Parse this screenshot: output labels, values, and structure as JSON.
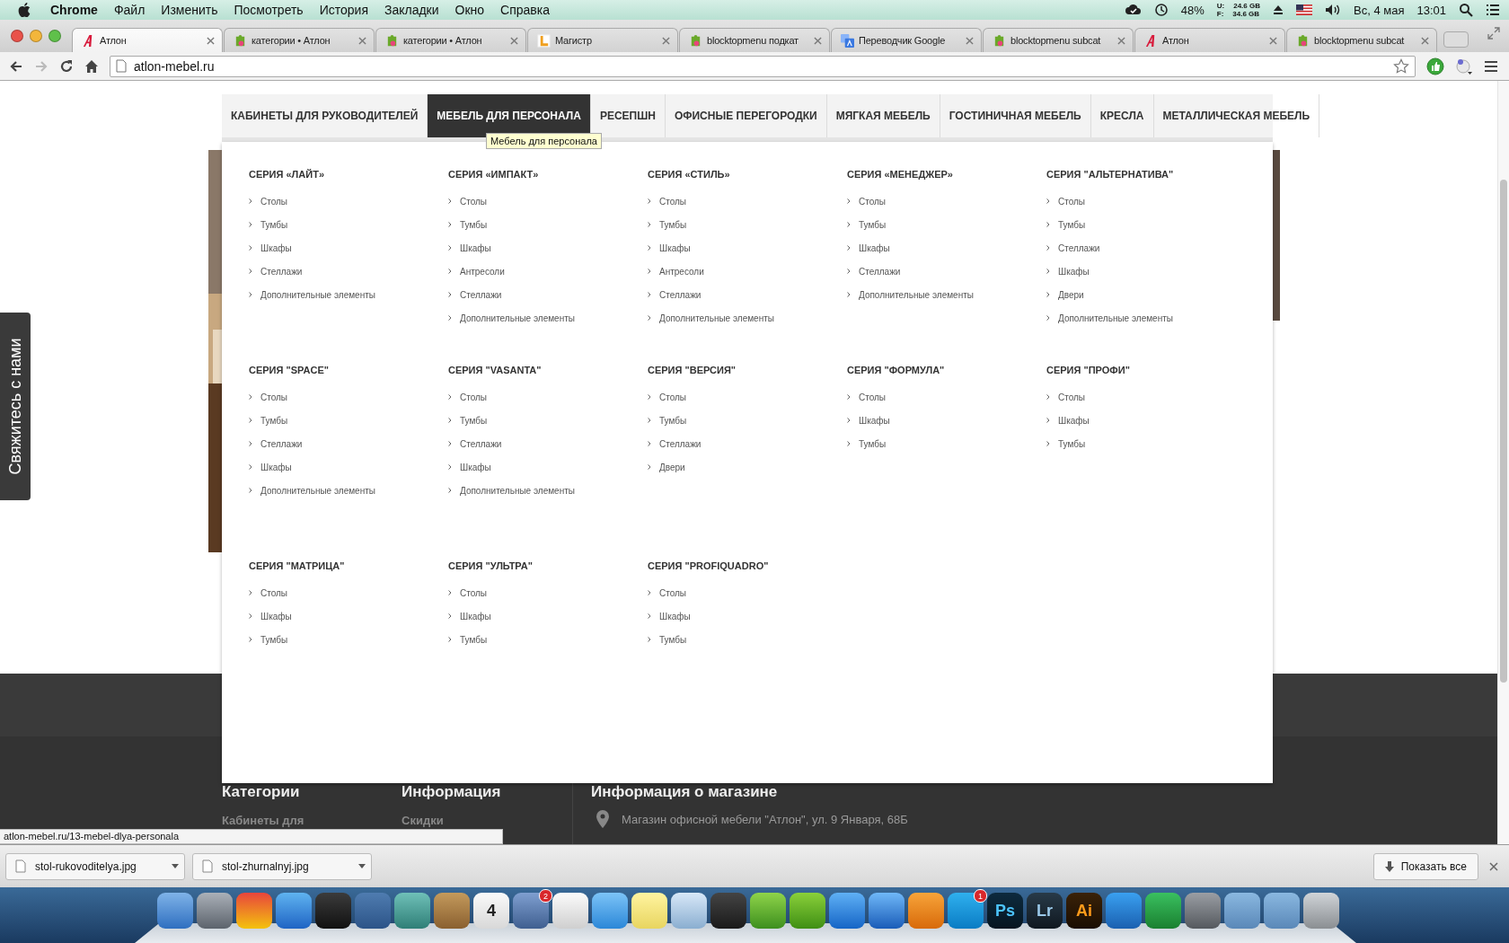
{
  "menubar": {
    "app": "Chrome",
    "items": [
      "Файл",
      "Изменить",
      "Посмотреть",
      "История",
      "Закладки",
      "Окно",
      "Справка"
    ],
    "battery": "48%",
    "storage": [
      {
        "label": "U:",
        "value": "24.6 GB"
      },
      {
        "label": "F:",
        "value": "34.6 GB"
      }
    ],
    "date": "Вс, 4 мая",
    "time": "13:01"
  },
  "tabs": [
    {
      "title": "Атлон",
      "kind": "atlon",
      "selected": true
    },
    {
      "title": "категории • Атлон",
      "kind": "shop",
      "selected": false
    },
    {
      "title": "категории • Атлон",
      "kind": "shop",
      "selected": false
    },
    {
      "title": "Магистр",
      "kind": "magistr",
      "selected": false
    },
    {
      "title": "blocktopmenu подкат",
      "kind": "shop",
      "selected": false
    },
    {
      "title": "Переводчик Google",
      "kind": "translate",
      "selected": false
    },
    {
      "title": "blocktopmenu subcat",
      "kind": "shop",
      "selected": false
    },
    {
      "title": "Атлон",
      "kind": "atlon",
      "selected": false
    },
    {
      "title": "blocktopmenu subcat",
      "kind": "shop",
      "selected": false
    }
  ],
  "toolbar": {
    "url": "atlon-mebel.ru",
    "forward_disabled": true
  },
  "nav": [
    {
      "label": "КАБИНЕТЫ ДЛЯ РУКОВОДИТЕЛЕЙ",
      "selected": false
    },
    {
      "label": "МЕБЕЛЬ ДЛЯ ПЕРСОНАЛА",
      "selected": true
    },
    {
      "label": "РЕСЕПШН",
      "selected": false
    },
    {
      "label": "ОФИСНЫЕ ПЕРЕГОРОДКИ",
      "selected": false
    },
    {
      "label": "МЯГКАЯ МЕБЕЛЬ",
      "selected": false
    },
    {
      "label": "ГОСТИНИЧНАЯ МЕБЕЛЬ",
      "selected": false
    },
    {
      "label": "КРЕСЛА",
      "selected": false
    },
    {
      "label": "МЕТАЛЛИЧЕСКАЯ МЕБЕЛЬ",
      "selected": false
    }
  ],
  "tooltip": "Мебель для персонала",
  "series": [
    {
      "title": "СЕРИЯ «ЛАЙТ»",
      "items": [
        "Столы",
        "Тумбы",
        "Шкафы",
        "Стеллажи",
        "Дополнительные элементы"
      ]
    },
    {
      "title": "СЕРИЯ «ИМПАКТ»",
      "items": [
        "Столы",
        "Тумбы",
        "Шкафы",
        "Антресоли",
        "Стеллажи",
        "Дополнительные элементы"
      ]
    },
    {
      "title": "СЕРИЯ «СТИЛЬ»",
      "items": [
        "Столы",
        "Тумбы",
        "Шкафы",
        "Антресоли",
        "Стеллажи",
        "Дополнительные элементы"
      ]
    },
    {
      "title": "СЕРИЯ «МЕНЕДЖЕР»",
      "items": [
        "Столы",
        "Тумбы",
        "Шкафы",
        "Стеллажи",
        "Дополнительные элементы"
      ]
    },
    {
      "title": "СЕРИЯ \"АЛЬТЕРНАТИВА\"",
      "items": [
        "Столы",
        "Тумбы",
        "Стеллажи",
        "Шкафы",
        "Двери",
        "Дополнительные элементы"
      ]
    },
    {
      "title": "СЕРИЯ \"SPACE\"",
      "items": [
        "Столы",
        "Тумбы",
        "Стеллажи",
        "Шкафы",
        "Дополнительные элементы"
      ]
    },
    {
      "title": "СЕРИЯ \"VASANTA\"",
      "items": [
        "Столы",
        "Тумбы",
        "Стеллажи",
        "Шкафы",
        "Дополнительные элементы"
      ]
    },
    {
      "title": "СЕРИЯ \"ВЕРСИЯ\"",
      "items": [
        "Столы",
        "Тумбы",
        "Стеллажи",
        "Двери"
      ]
    },
    {
      "title": "СЕРИЯ \"ФОРМУЛА\"",
      "items": [
        "Столы",
        "Шкафы",
        "Тумбы"
      ]
    },
    {
      "title": "СЕРИЯ \"ПРОФИ\"",
      "items": [
        "Столы",
        "Шкафы",
        "Тумбы"
      ]
    },
    {
      "title": "СЕРИЯ \"МАТРИЦА\"",
      "items": [
        "Столы",
        "Шкафы",
        "Тумбы"
      ]
    },
    {
      "title": "СЕРИЯ \"УЛЬТРА\"",
      "items": [
        "Столы",
        "Шкафы",
        "Тумбы"
      ]
    },
    {
      "title": "СЕРИЯ \"PROFIQUADRO\"",
      "items": [
        "Столы",
        "Шкафы",
        "Тумбы"
      ]
    }
  ],
  "contact_tab": "Свяжитесь с нами",
  "footer": {
    "columns": [
      {
        "heading": "Категории",
        "link": "Кабинеты для"
      },
      {
        "heading": "Информация",
        "link": "Скидки"
      }
    ],
    "store": {
      "heading": "Информация о магазине",
      "address": "Магазин офисной мебели \"Атлон\", ул. 9 Января, 68Б"
    }
  },
  "status_url": "atlon-mebel.ru/13-mebel-dlya-personala",
  "downloads": {
    "files": [
      "stol-rukovoditelya.jpg",
      "stol-zhurnalnyj.jpg"
    ],
    "show_all": "Показать все"
  },
  "dock": [
    {
      "kind": "finder"
    },
    {
      "kind": "rocket"
    },
    {
      "kind": "chrome"
    },
    {
      "kind": "compass"
    },
    {
      "kind": "goat"
    },
    {
      "kind": "vk"
    },
    {
      "kind": "globe"
    },
    {
      "kind": "contacts"
    },
    {
      "kind": "calendar",
      "label": "4"
    },
    {
      "kind": "stamp",
      "badge": "2"
    },
    {
      "kind": "list"
    },
    {
      "kind": "chat"
    },
    {
      "kind": "notes"
    },
    {
      "kind": "preview"
    },
    {
      "kind": "steam"
    },
    {
      "kind": "leaf"
    },
    {
      "kind": "torrent"
    },
    {
      "kind": "appstore"
    },
    {
      "kind": "music"
    },
    {
      "kind": "book"
    },
    {
      "kind": "skype",
      "badge": "1"
    },
    {
      "kind": "ps",
      "label": "Ps"
    },
    {
      "kind": "lr",
      "label": "Lr"
    },
    {
      "kind": "ai",
      "label": "Ai"
    },
    {
      "kind": "word"
    },
    {
      "kind": "excel"
    },
    {
      "kind": "settings"
    },
    {
      "kind": "folder"
    },
    {
      "kind": "folder"
    },
    {
      "kind": "trash"
    }
  ]
}
